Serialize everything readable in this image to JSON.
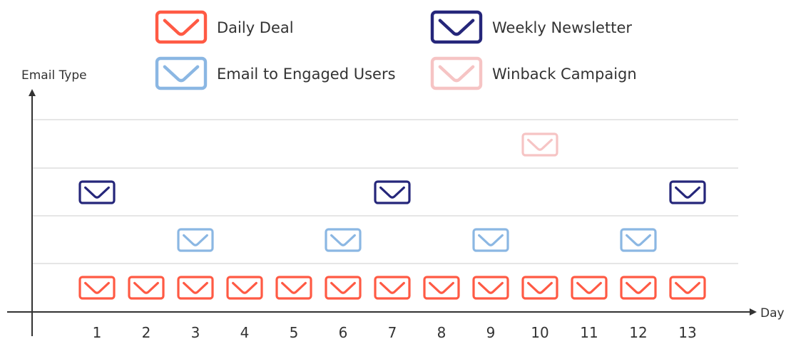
{
  "chart_data": {
    "type": "scatter",
    "title": "",
    "xlabel": "Day",
    "ylabel": "Email Type",
    "categories": [
      "1",
      "2",
      "3",
      "4",
      "5",
      "6",
      "7",
      "8",
      "9",
      "10",
      "11",
      "12",
      "13"
    ],
    "ylim": [
      0,
      5
    ],
    "grid": true,
    "legend_position": "top",
    "series": [
      {
        "name": "Daily Deal",
        "color": "#ff5a44",
        "level": 1,
        "x": [
          1,
          2,
          3,
          4,
          5,
          6,
          7,
          8,
          9,
          10,
          11,
          12,
          13
        ]
      },
      {
        "name": "Email to Engaged Users",
        "color": "#8bb7e3",
        "level": 2,
        "x": [
          3,
          6,
          9,
          12
        ]
      },
      {
        "name": "Weekly Newsletter",
        "color": "#25267a",
        "level": 3,
        "x": [
          1,
          7,
          13
        ]
      },
      {
        "name": "Winback Campaign",
        "color": "#f6c4c4",
        "level": 4,
        "x": [
          10
        ]
      }
    ],
    "marker_icon": "envelope-icon"
  }
}
